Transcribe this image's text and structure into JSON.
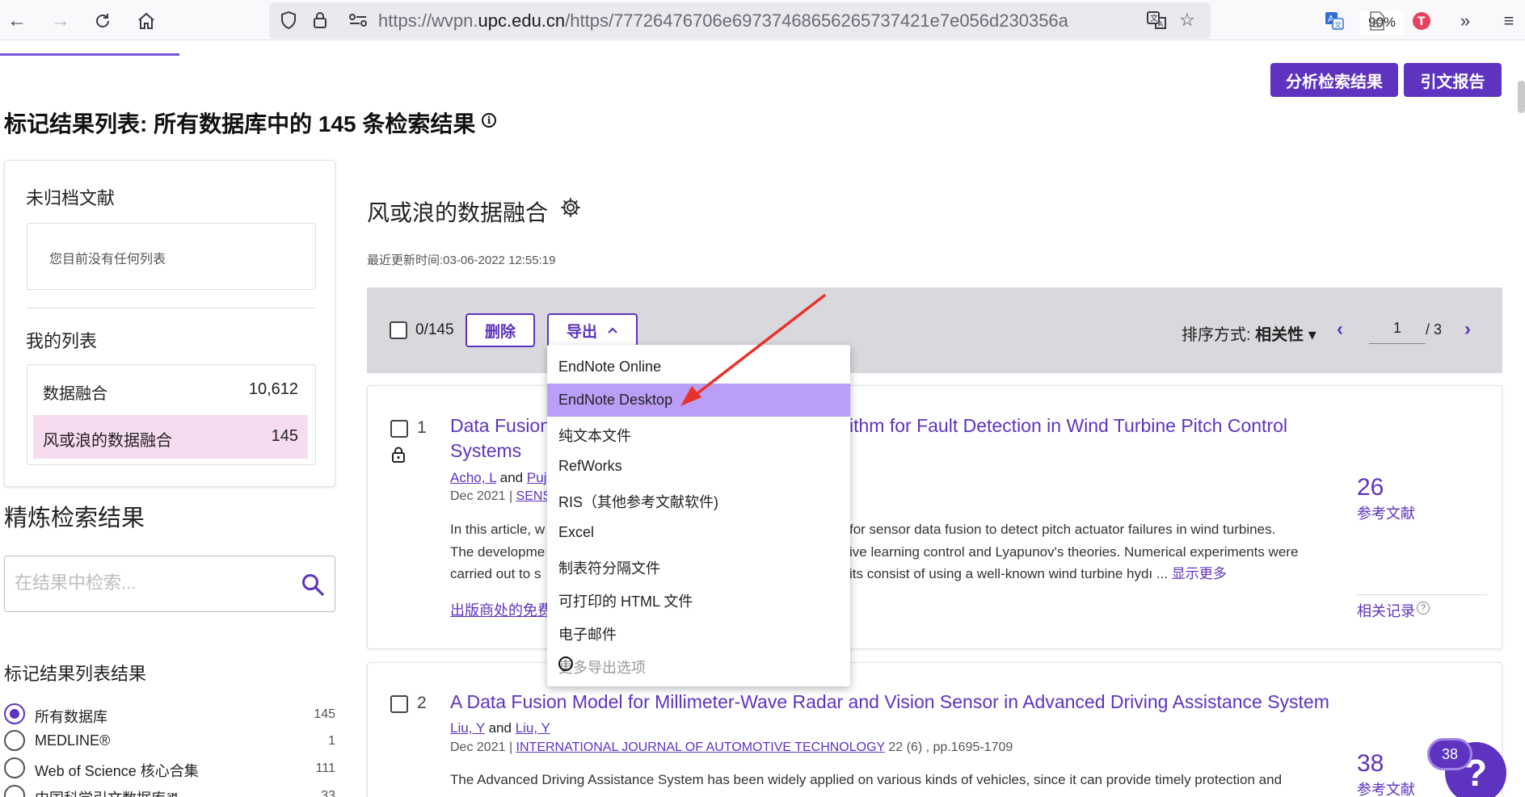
{
  "browser": {
    "url_prefix": "https://wvpn.",
    "url_domain": "upc.edu.cn",
    "url_rest": "/https/77726476706e69737468656265737421e7e056d230356a",
    "zoom": "90%"
  },
  "header": {
    "analyze_button": "分析检索结果",
    "citation_button": "引文报告"
  },
  "page_title": "标记结果列表: 所有数据库中的 145 条检索结果",
  "info_glyph": "i",
  "sidebar": {
    "uncategorized_heading": "未归档文献",
    "no_list_text": "您目前没有任何列表",
    "my_lists_heading": "我的列表",
    "lists": [
      {
        "name": "数据融合",
        "count": "10,612"
      },
      {
        "name": "风或浪的数据融合",
        "count": "145"
      }
    ],
    "refine_title": "精炼检索结果",
    "search_placeholder": "在结果中检索...",
    "filter_title": "标记结果列表结果",
    "databases": [
      {
        "name": "所有数据库",
        "count": "145"
      },
      {
        "name": "MEDLINE®",
        "count": "1"
      },
      {
        "name": "Web of Science 核心合集",
        "count": "111"
      },
      {
        "name": "中国科学引文数据库℠",
        "count": "33"
      }
    ]
  },
  "main": {
    "list_name": "风或浪的数据融合",
    "updated": "最近更新时间:03-06-2022 12:55:19",
    "toolbar": {
      "selected_count": "0/145",
      "delete_label": "删除",
      "export_label": "导出",
      "sort_prefix": "排序方式:",
      "sort_value": "相关性",
      "page_current": "1",
      "page_total": "/ 3"
    },
    "records": [
      {
        "index": "1",
        "title_left": "Data Fusion",
        "title_right": "ithm for Fault Detection in Wind Turbine Pitch Control",
        "title_line2": "Systems",
        "author1": "Acho, L",
        "and": "and",
        "author2": "Puj",
        "date": "Dec 2021 |",
        "journal": "SENS",
        "abstract_l1a": "In this article, w",
        "abstract_l1b": "for sensor data fusion to detect pitch actuator failures in wind turbines.",
        "abstract_l2a": "The developme",
        "abstract_l2b": "ive learning control and Lyapunov's theories. Numerical experiments were",
        "abstract_l3a": "carried out to s",
        "abstract_l3b": "its consist of using a well-known wind turbine hydı ...",
        "show_more": "显示更多",
        "free_link": "出版商处的免费",
        "cite_count": "26",
        "cite_label": "参考文献",
        "related": "相关记录",
        "related_badge": "?"
      },
      {
        "index": "2",
        "title": "A Data Fusion Model for Millimeter-Wave Radar and Vision Sensor in Advanced Driving Assistance System",
        "author1": "Liu, Y",
        "and": "and",
        "author2": "Liu, Y",
        "date": "Dec 2021 |",
        "journal": "INTERNATIONAL JOURNAL OF AUTOMOTIVE TECHNOLOGY",
        "issue": "22 (6) , pp.1695-1709",
        "abstract_l1": "The Advanced Driving Assistance System has been widely applied on various kinds of vehicles, since it can provide timely protection and",
        "cite_count": "38",
        "cite_label": "参考文献"
      }
    ]
  },
  "export_menu": {
    "items": [
      "EndNote Online",
      "EndNote Desktop",
      "纯文本文件",
      "RefWorks",
      "RIS（其他参考文献软件)",
      "Excel",
      "制表符分隔文件",
      "可打印的 HTML 文件",
      "电子邮件",
      "更多导出选项"
    ],
    "highlighted_index": 1,
    "disabled_index": 9
  },
  "help": {
    "badge_count": "38",
    "glyph": "?"
  },
  "colors": {
    "accent": "#5e33bf",
    "highlight": "#bb9ef7",
    "selected_list": "#f6dcf0",
    "annotation_arrow": "#e8332a"
  }
}
